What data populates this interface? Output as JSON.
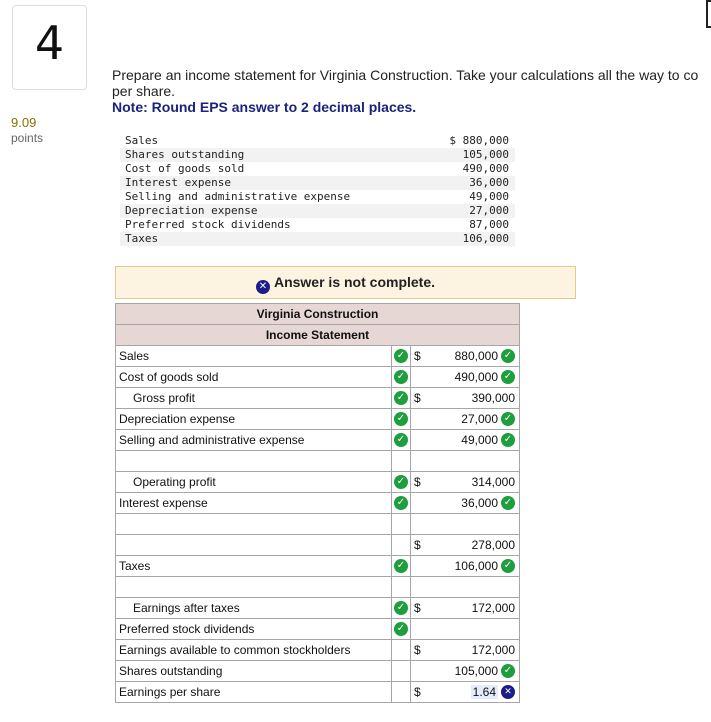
{
  "question": {
    "number": "4",
    "points_value": "9.09",
    "points_label": "points",
    "prompt_line1": "Prepare an income statement for Virginia Construction. Take your calculations all the way to co",
    "prompt_line2": "per share.",
    "note": "Note: Round EPS answer to 2 decimal places."
  },
  "given_data": [
    {
      "label": "Sales",
      "value": "$ 880,000"
    },
    {
      "label": "Shares outstanding",
      "value": "105,000"
    },
    {
      "label": "Cost of goods sold",
      "value": "490,000"
    },
    {
      "label": "Interest expense",
      "value": "36,000"
    },
    {
      "label": "Selling and administrative expense",
      "value": "49,000"
    },
    {
      "label": "Depreciation expense",
      "value": "27,000"
    },
    {
      "label": "Preferred stock dividends",
      "value": "87,000"
    },
    {
      "label": "Taxes",
      "value": "106,000"
    }
  ],
  "banner": {
    "icon": "x-circle-icon",
    "text": "Answer is not complete."
  },
  "statement": {
    "company": "Virginia Construction",
    "title": "Income Statement",
    "rows": [
      {
        "label": "Sales",
        "indent": false,
        "label_status": "correct",
        "dollar": "$",
        "amount": "880,000",
        "amount_status": "correct"
      },
      {
        "label": "Cost of goods sold",
        "indent": false,
        "label_status": "correct",
        "dollar": "",
        "amount": "490,000",
        "amount_status": "correct"
      },
      {
        "label": "Gross profit",
        "indent": true,
        "label_status": "correct",
        "dollar": "$",
        "amount": "390,000",
        "amount_status": ""
      },
      {
        "label": "Depreciation expense",
        "indent": false,
        "label_status": "correct",
        "dollar": "",
        "amount": "27,000",
        "amount_status": "correct"
      },
      {
        "label": "Selling and administrative expense",
        "indent": false,
        "label_status": "correct",
        "dollar": "",
        "amount": "49,000",
        "amount_status": "correct"
      },
      {
        "label": "",
        "indent": false,
        "label_status": "",
        "dollar": "",
        "amount": "",
        "amount_status": ""
      },
      {
        "label": "Operating profit",
        "indent": true,
        "label_status": "correct",
        "dollar": "$",
        "amount": "314,000",
        "amount_status": ""
      },
      {
        "label": "Interest expense",
        "indent": false,
        "label_status": "correct",
        "dollar": "",
        "amount": "36,000",
        "amount_status": "correct"
      },
      {
        "label": "",
        "indent": false,
        "label_status": "",
        "dollar": "",
        "amount": "",
        "amount_status": ""
      },
      {
        "label": "",
        "indent": false,
        "label_status": "",
        "dollar": "$",
        "amount": "278,000",
        "amount_status": ""
      },
      {
        "label": "Taxes",
        "indent": false,
        "label_status": "correct",
        "dollar": "",
        "amount": "106,000",
        "amount_status": "correct"
      },
      {
        "label": "",
        "indent": false,
        "label_status": "",
        "dollar": "",
        "amount": "",
        "amount_status": ""
      },
      {
        "label": "Earnings after taxes",
        "indent": true,
        "label_status": "correct",
        "dollar": "$",
        "amount": "172,000",
        "amount_status": ""
      },
      {
        "label": "Preferred stock dividends",
        "indent": false,
        "label_status": "correct",
        "dollar": "",
        "amount": "",
        "amount_status": ""
      },
      {
        "label": "Earnings available to common stockholders",
        "indent": false,
        "label_status": "",
        "dollar": "$",
        "amount": "172,000",
        "amount_status": ""
      },
      {
        "label": "Shares outstanding",
        "indent": false,
        "label_status": "",
        "dollar": "",
        "amount": "105,000",
        "amount_status": "correct"
      },
      {
        "label": "Earnings per share",
        "indent": false,
        "label_status": "",
        "dollar": "$",
        "amount": "1.64",
        "amount_status": "incorrect"
      }
    ]
  },
  "colors": {
    "correct": "#1e9e3c",
    "incorrect": "#1d1d8a",
    "note": "#1a237e",
    "header_bg": "#e7d7d4",
    "banner_bg": "#fcf3e1"
  }
}
